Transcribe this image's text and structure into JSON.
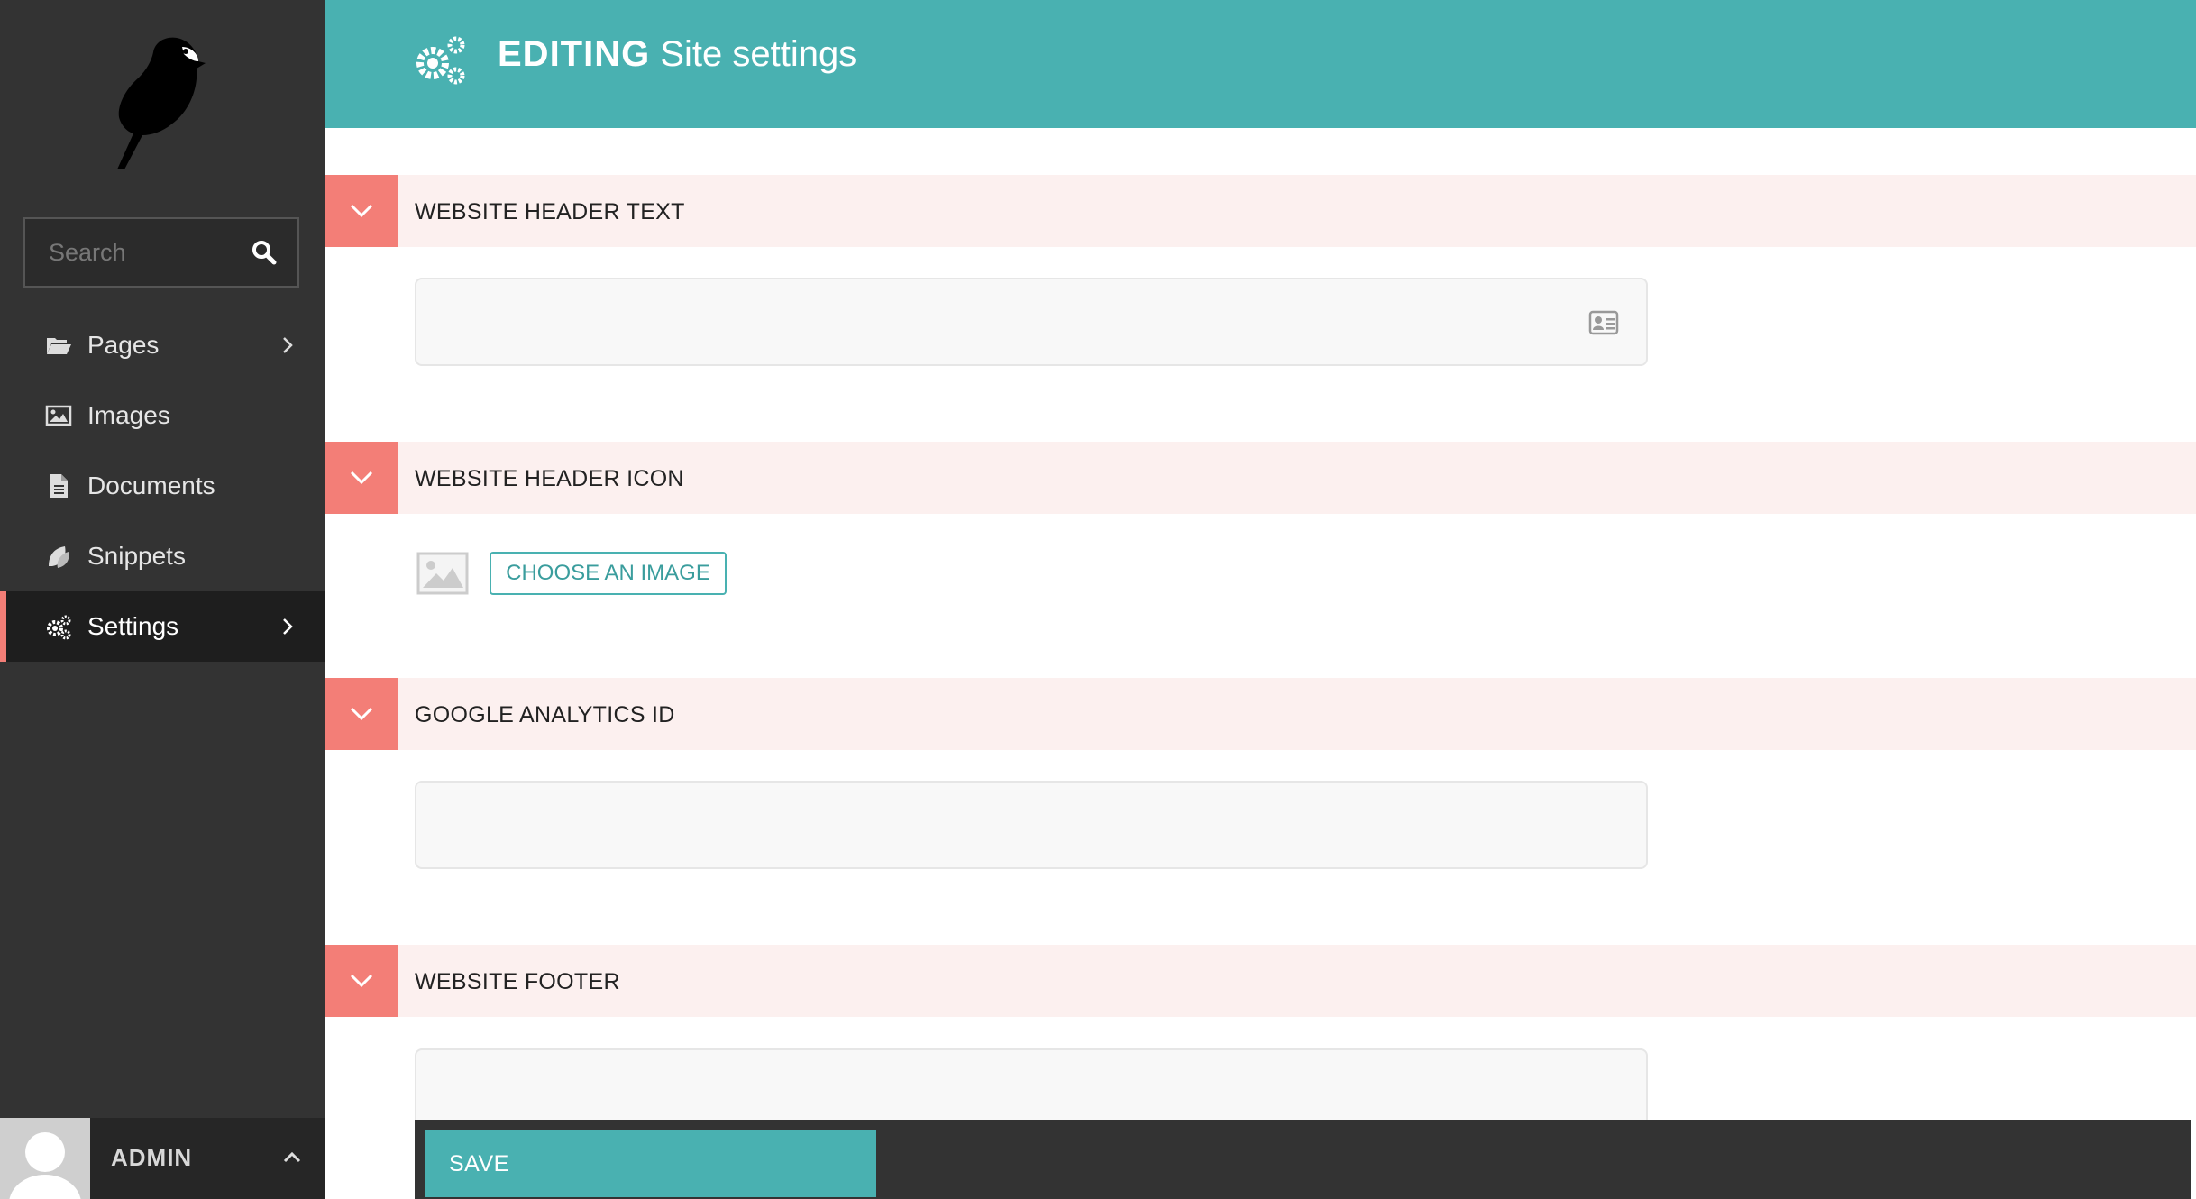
{
  "sidebar": {
    "search": {
      "placeholder": "Search"
    },
    "items": [
      {
        "label": "Pages",
        "icon": "folder-open-icon",
        "has_submenu": true,
        "active": false
      },
      {
        "label": "Images",
        "icon": "image-icon",
        "has_submenu": false,
        "active": false
      },
      {
        "label": "Documents",
        "icon": "document-icon",
        "has_submenu": false,
        "active": false
      },
      {
        "label": "Snippets",
        "icon": "snippet-icon",
        "has_submenu": false,
        "active": false
      },
      {
        "label": "Settings",
        "icon": "cogs-icon",
        "has_submenu": true,
        "active": true
      }
    ],
    "account": {
      "name": "ADMIN"
    }
  },
  "header": {
    "action": "EDITING",
    "title": "Site settings"
  },
  "sections": [
    {
      "title": "WEBSITE HEADER TEXT",
      "value": ""
    },
    {
      "title": "WEBSITE HEADER ICON",
      "choose_label": "CHOOSE AN IMAGE"
    },
    {
      "title": "GOOGLE ANALYTICS ID",
      "value": ""
    },
    {
      "title": "WEBSITE FOOTER",
      "value": ""
    }
  ],
  "footer": {
    "save_label": "SAVE"
  },
  "colors": {
    "primary": "#49b1b1",
    "accent": "#f37e77",
    "section_bg": "#fcf0ef",
    "sidebar_bg": "#333333"
  }
}
